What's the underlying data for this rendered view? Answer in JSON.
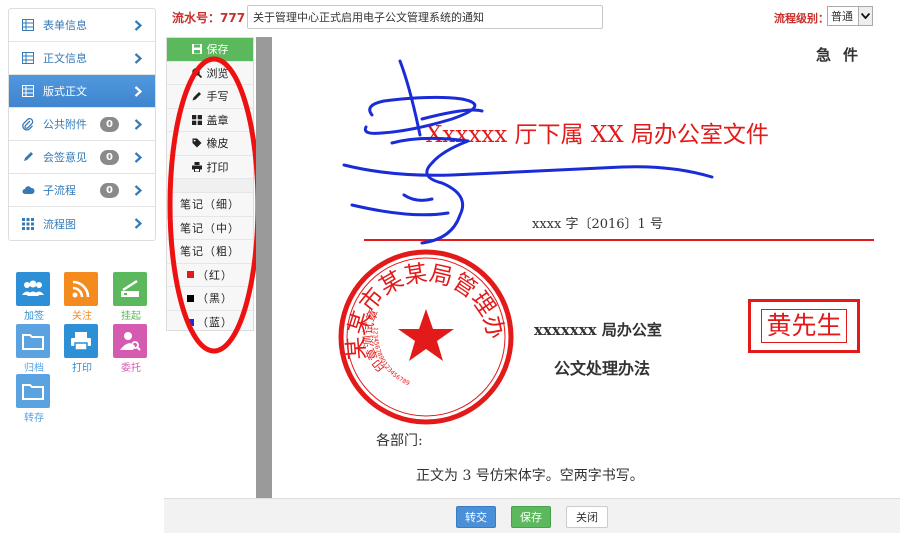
{
  "nav": {
    "items": [
      {
        "label": "表单信息",
        "icon": "table-icon",
        "badge": null,
        "active": false
      },
      {
        "label": "正文信息",
        "icon": "table-icon",
        "badge": null,
        "active": false
      },
      {
        "label": "版式正文",
        "icon": "table-icon",
        "badge": null,
        "active": true
      },
      {
        "label": "公共附件",
        "icon": "paperclip-icon",
        "badge": "0",
        "active": false
      },
      {
        "label": "会签意见",
        "icon": "pencil-icon",
        "badge": "0",
        "active": false
      },
      {
        "label": "子流程",
        "icon": "cloud-icon",
        "badge": "0",
        "active": false
      },
      {
        "label": "流程图",
        "icon": "grid-icon",
        "badge": null,
        "active": false
      }
    ]
  },
  "tiles": [
    {
      "label": "加签",
      "icon": "users-icon",
      "color": "#2d8fd5"
    },
    {
      "label": "关注",
      "icon": "rss-icon",
      "color": "#f48b1f"
    },
    {
      "label": "挂起",
      "icon": "scanner-icon",
      "color": "#5cb85c"
    },
    {
      "label": "归档",
      "icon": "folder-icon",
      "color": "#5aa2e0"
    },
    {
      "label": "打印",
      "icon": "printer-icon",
      "color": "#2d8fd5"
    },
    {
      "label": "委托",
      "icon": "user-search-icon",
      "color": "#d55bb0"
    },
    {
      "label": "转存",
      "icon": "folder-icon",
      "color": "#5aa2e0"
    }
  ],
  "header": {
    "serial_label": "流水号：777",
    "title_value": "关于管理中心正式启用电子公文管理系统的通知",
    "level_label": "流程级别：",
    "level_value": "普通"
  },
  "tools": {
    "save": "保存",
    "preview": "浏览",
    "handwrite": "手写",
    "stamp": "盖章",
    "eraser": "橡皮",
    "print": "打印",
    "pen_thin": "笔记（细）",
    "pen_medium": "笔记（中）",
    "pen_thick": "笔记（粗）",
    "color_red": "（红）",
    "color_black": "（黑）",
    "color_blue": "（蓝）"
  },
  "colors": {
    "red": "#e31a1a",
    "black": "#000000",
    "blue": "#1a2bd8",
    "accent_blue": "#4a90d9",
    "green": "#5cb85c"
  },
  "document": {
    "urgency": "急件",
    "headline": "Xxxxxx 厅下属 XX 局办公室文件",
    "doc_number": "xxxx 字〔2016〕1 号",
    "seal_text": "某某市某某局管理办",
    "seal_inner_text": "印章测试章",
    "seal_digits": "1234567890123456789",
    "office": "xxxxxxx 局办公室",
    "method": "公文处理办法",
    "salutation": "各部门:",
    "body": "正文为 3 号仿宋体字。空两字书写。",
    "name_stamp": "黄先生"
  },
  "footer": {
    "transfer": "转交",
    "save": "保存",
    "close": "关闭"
  }
}
